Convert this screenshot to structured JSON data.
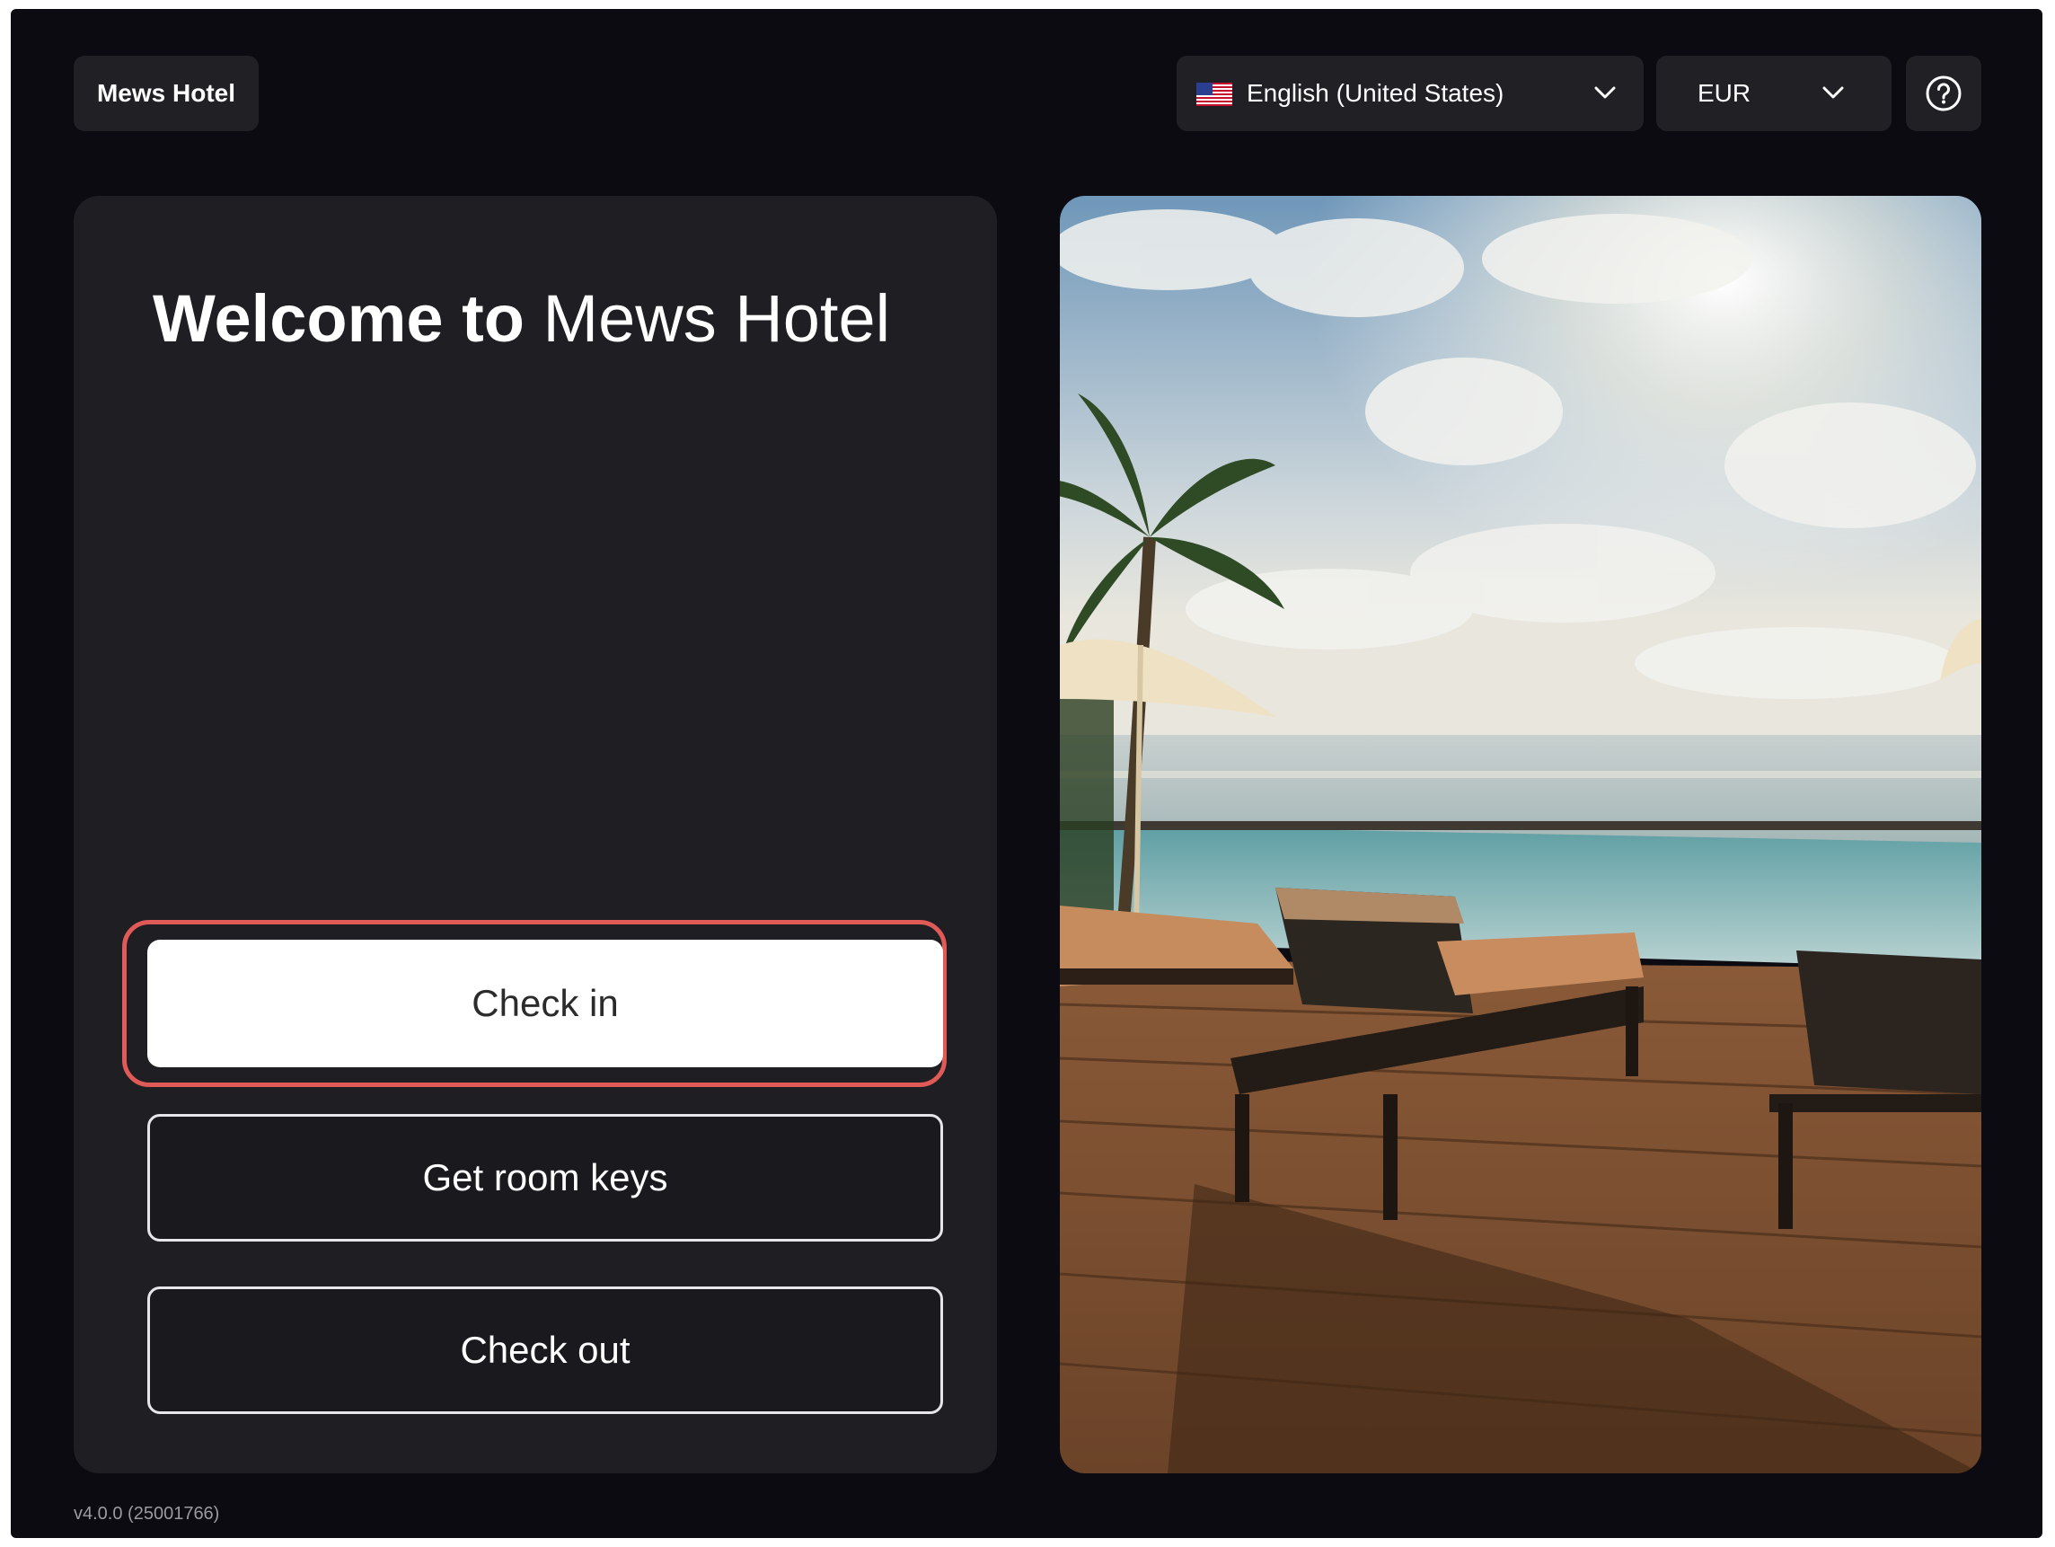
{
  "header": {
    "hotel_name": "Mews Hotel",
    "language": {
      "label": "English (United States)",
      "flag_icon": "us-flag-icon"
    },
    "currency": {
      "label": "EUR"
    },
    "help_icon": "help-icon"
  },
  "main": {
    "welcome_prefix": "Welcome to",
    "welcome_hotel": "Mews Hotel",
    "buttons": {
      "check_in": "Check in",
      "get_room_keys": "Get room keys",
      "check_out": "Check out"
    }
  },
  "footer": {
    "version": "v4.0.0 (25001766)"
  },
  "colors": {
    "background": "#0c0b11",
    "panel": "#1f1e23",
    "highlight": "#e05a57"
  }
}
